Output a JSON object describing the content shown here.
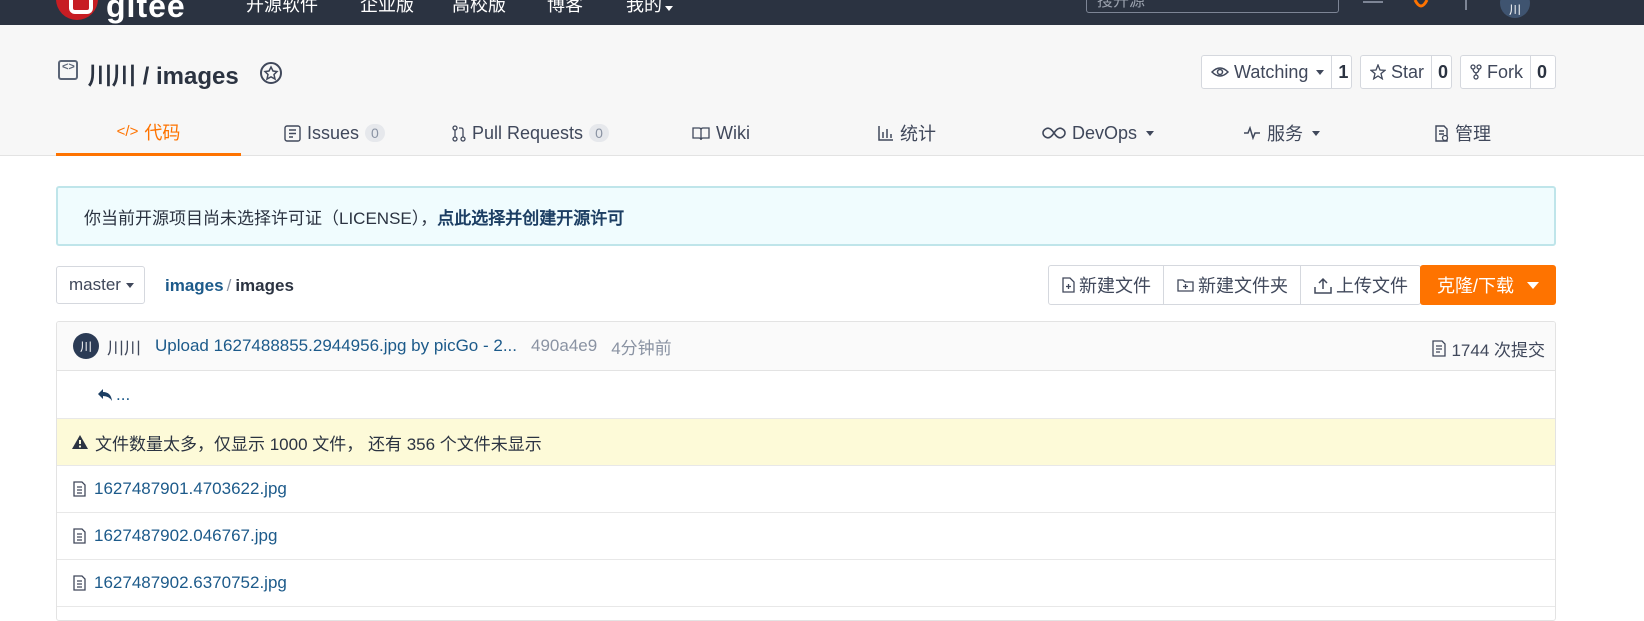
{
  "topnav": {
    "logo_text": "gitee",
    "items": [
      "开源软件",
      "企业版",
      "高校版",
      "博客",
      "我的"
    ],
    "search_placeholder": "搜开源",
    "user_avatar_text": "川"
  },
  "repo": {
    "title": "川川 / images",
    "watching_label": "Watching",
    "watching_count": "1",
    "star_label": "Star",
    "star_count": "0",
    "fork_label": "Fork",
    "fork_count": "0"
  },
  "tabs": [
    {
      "label": "代码"
    },
    {
      "label": "Issues",
      "count": "0"
    },
    {
      "label": "Pull Requests",
      "count": "0"
    },
    {
      "label": "Wiki"
    },
    {
      "label": "统计"
    },
    {
      "label": "DevOps"
    },
    {
      "label": "服务"
    },
    {
      "label": "管理"
    }
  ],
  "notice": {
    "text": "你当前开源项目尚未选择许可证（LICENSE），",
    "link": "点此选择并创建开源许可"
  },
  "branch": {
    "name": "master"
  },
  "breadcrumb": {
    "root": "images",
    "sep": "/",
    "current": "images"
  },
  "file_actions": {
    "new_file": "新建文件",
    "new_folder": "新建文件夹",
    "upload": "上传文件",
    "clone": "克隆/下载"
  },
  "commit": {
    "avatar_text": "川",
    "author": "川川",
    "message": "Upload 1627488855.2944956.jpg by picGo - 2...",
    "hash": "490a4e9",
    "time": "4分钟前",
    "count_text": "1744 次提交"
  },
  "back_link": "...",
  "warning": "文件数量太多，仅显示 1000 文件， 还有 356 个文件未显示",
  "files": [
    {
      "name": "1627487901.4703622.jpg"
    },
    {
      "name": "1627487902.046767.jpg"
    },
    {
      "name": "1627487902.6370752.jpg"
    }
  ],
  "colors": {
    "accent": "#fe7300",
    "topbar": "#2b3341",
    "link": "#1c5a8a"
  }
}
